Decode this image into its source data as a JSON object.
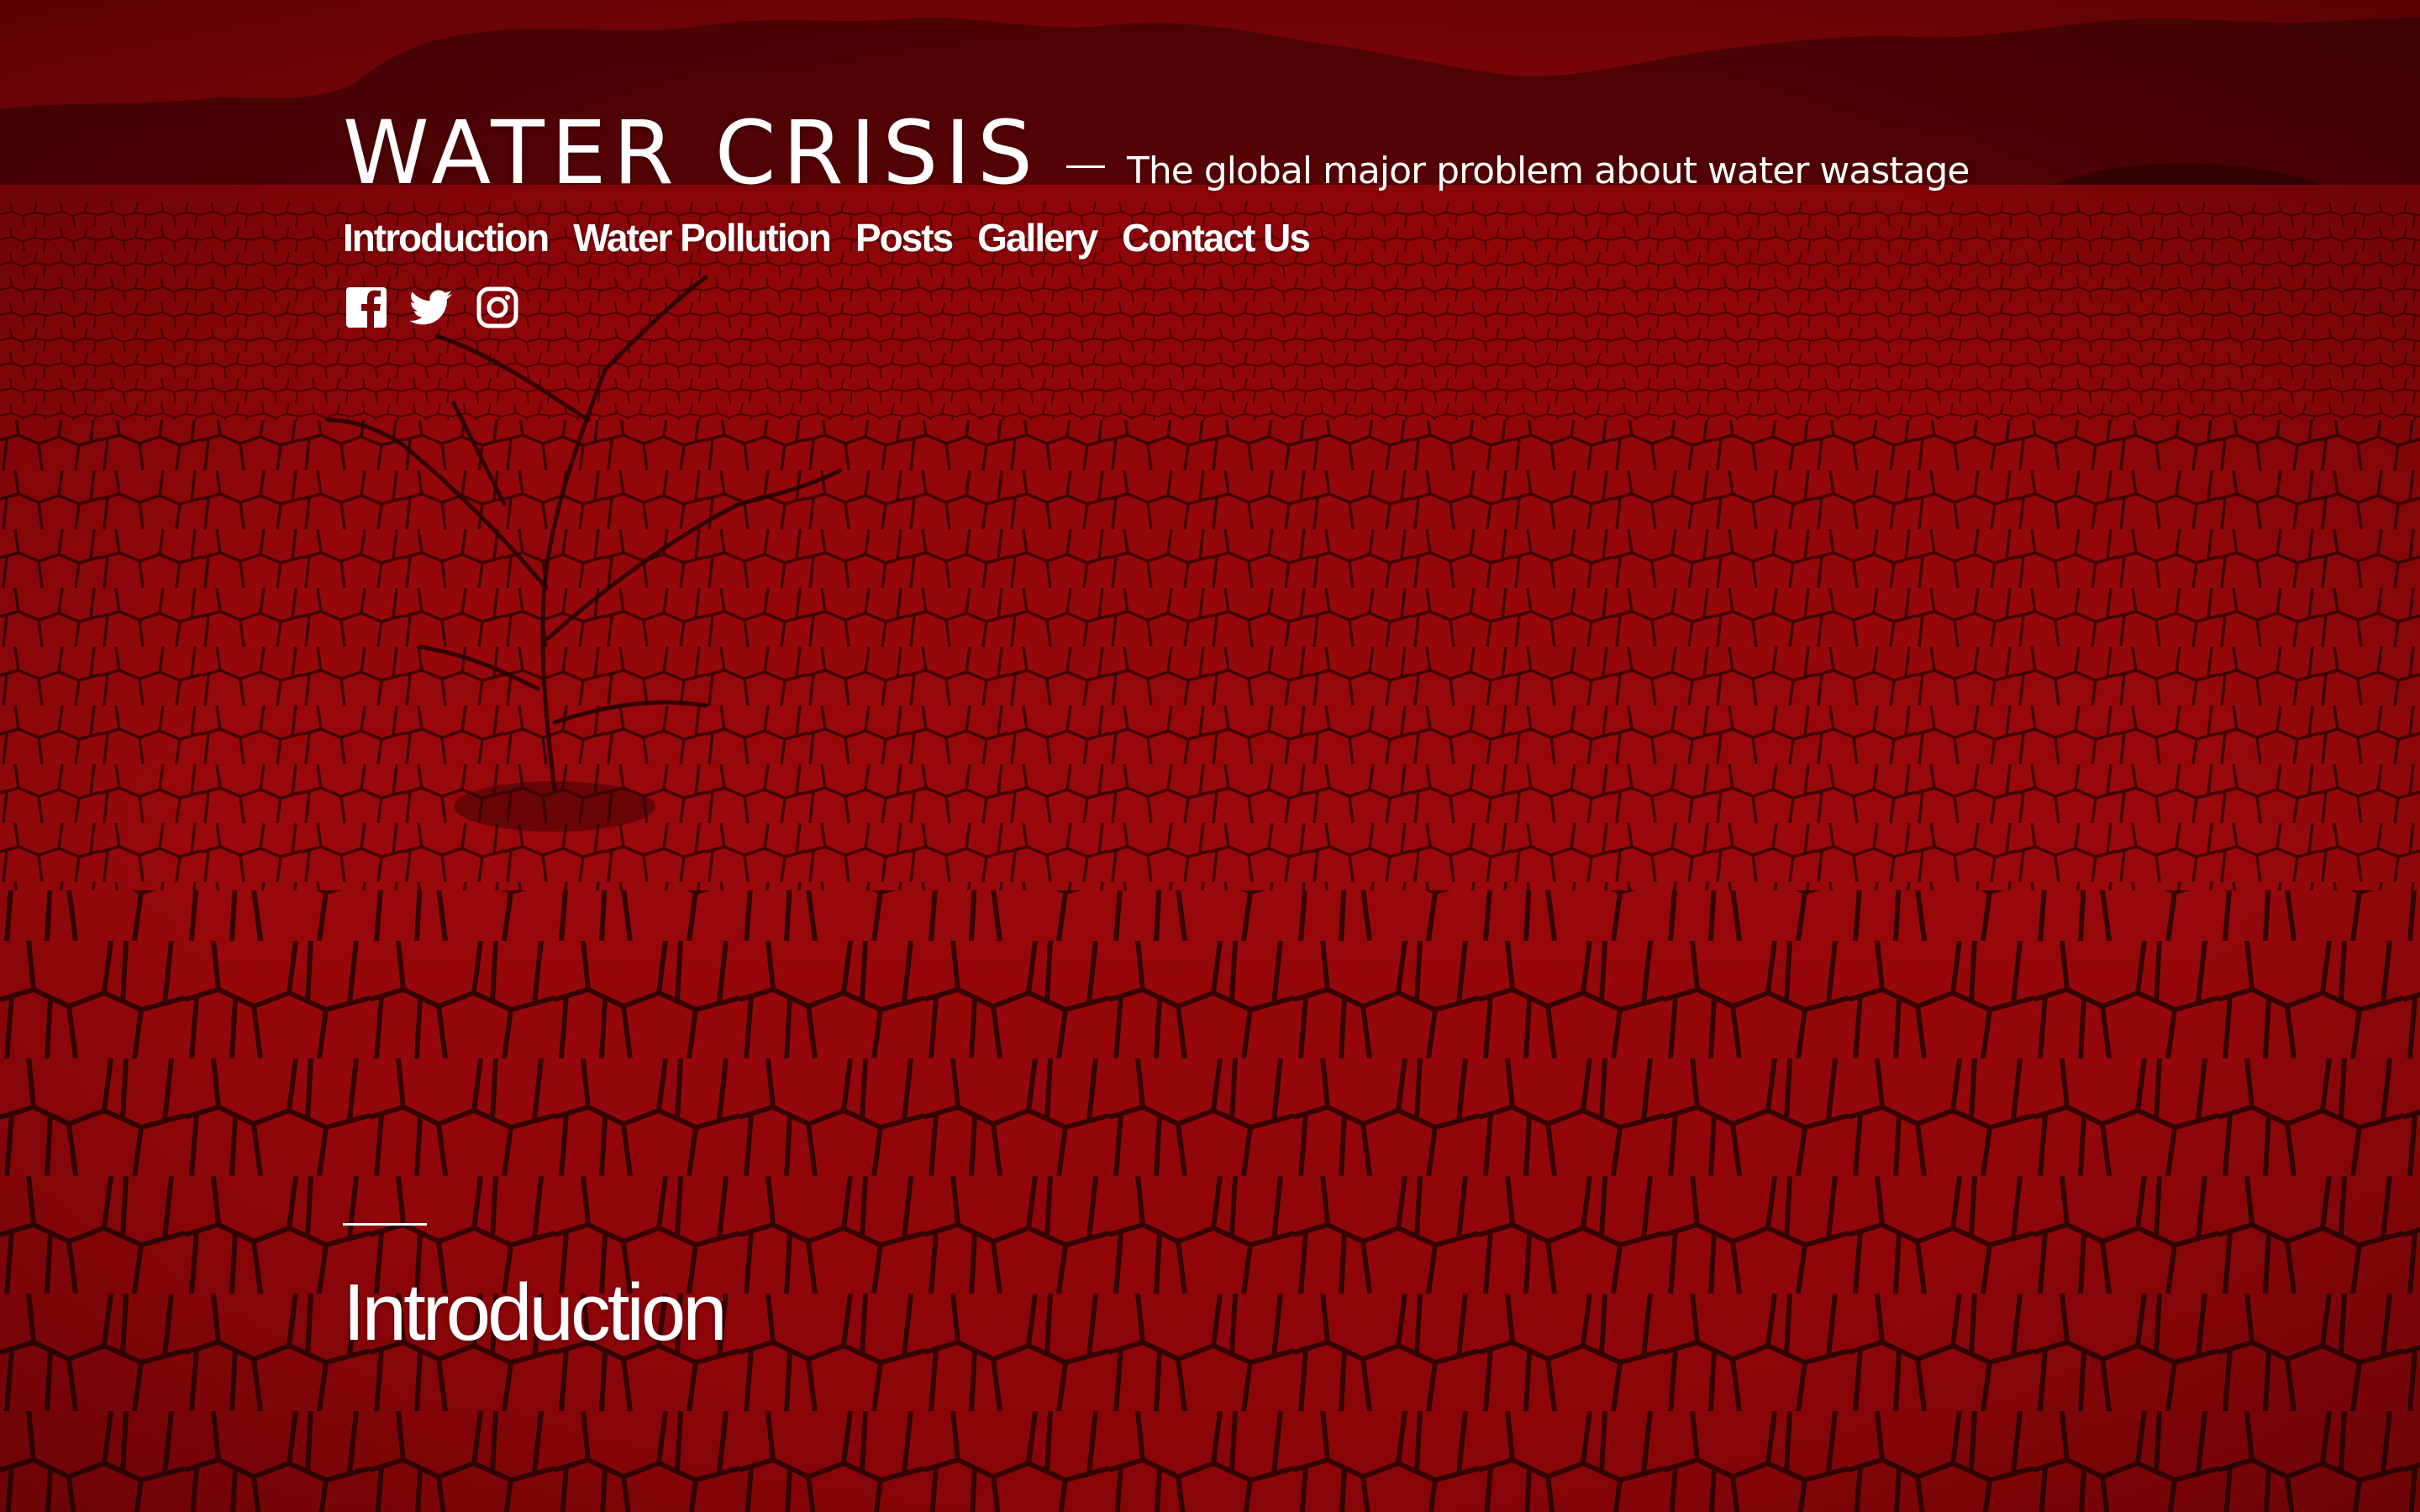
{
  "site": {
    "title": "WATER CRISIS",
    "tagline": "The global major problem about water wastage"
  },
  "nav": {
    "items": [
      {
        "label": "Introduction"
      },
      {
        "label": "Water Pollution"
      },
      {
        "label": "Posts"
      },
      {
        "label": "Gallery"
      },
      {
        "label": "Contact Us"
      }
    ]
  },
  "social": {
    "icons": [
      "facebook-icon",
      "twitter-icon",
      "instagram-icon"
    ]
  },
  "page": {
    "title": "Introduction"
  },
  "colors": {
    "tint": "#8a0508",
    "tint_dark": "#4a0204",
    "text": "#ffffff"
  }
}
